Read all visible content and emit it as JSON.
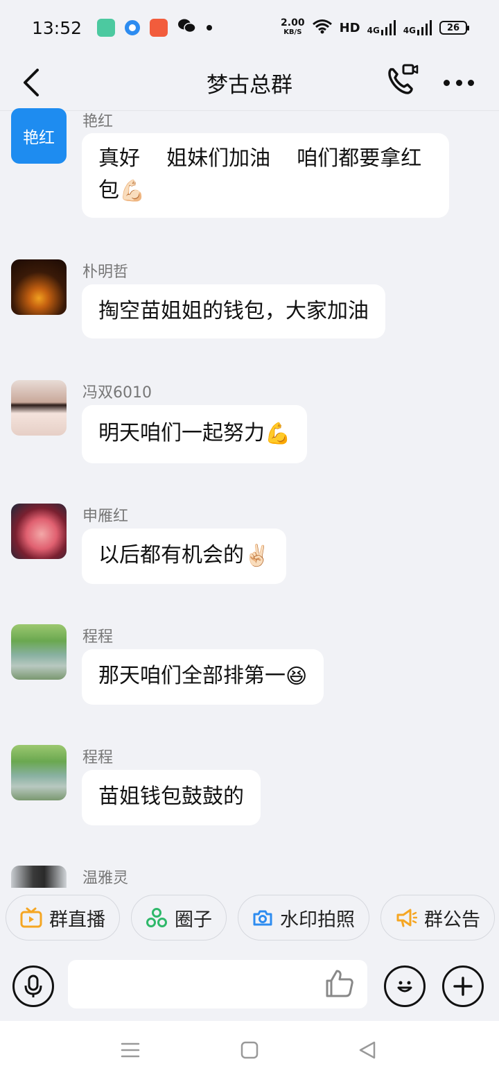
{
  "status_bar": {
    "time": "13:52",
    "net_speed_value": "2.00",
    "net_speed_unit": "KB/S",
    "hd_label": "HD",
    "signal1": "4G",
    "signal2": "4G",
    "battery": "26"
  },
  "header": {
    "title": "梦古总群"
  },
  "messages": [
    {
      "sender": "艳红",
      "avatar_text": "艳红",
      "text": "真好    姐妹们加油    咱们都要拿红包",
      "emoji": "💪🏻"
    },
    {
      "sender": "朴明哲",
      "text": "掏空苗姐姐的钱包，大家加油",
      "emoji": ""
    },
    {
      "sender": "冯双6010",
      "text": "明天咱们一起努力",
      "emoji": "💪"
    },
    {
      "sender": "申雁红",
      "text": "以后都有机会的",
      "emoji": "✌🏻"
    },
    {
      "sender": "程程",
      "text": "那天咱们全部排第一",
      "emoji": "😆"
    },
    {
      "sender": "程程",
      "text": "苗姐钱包鼓鼓的",
      "emoji": ""
    },
    {
      "sender": "温雅灵",
      "text": "",
      "emoji": ""
    }
  ],
  "quick_actions": [
    {
      "label": "群直播",
      "icon": "tv-icon"
    },
    {
      "label": "圈子",
      "icon": "circles-icon"
    },
    {
      "label": "水印拍照",
      "icon": "camera-icon"
    },
    {
      "label": "群公告",
      "icon": "megaphone-icon"
    }
  ],
  "input": {
    "placeholder": ""
  },
  "colors": {
    "background": "#f1f2f6",
    "bubble": "#ffffff",
    "avatar_blue": "#1e8cf0",
    "tv_orange": "#f5a623",
    "circles_green": "#2fb86a",
    "camera_blue": "#2d8cf0",
    "megaphone_orange": "#f5a623"
  }
}
